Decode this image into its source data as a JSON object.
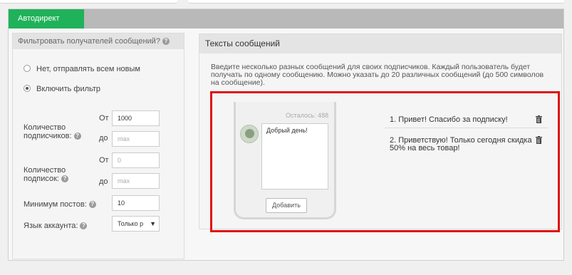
{
  "tab": {
    "label": "Автодирект"
  },
  "filter": {
    "title": "Фильтровать получателей сообщений?",
    "radio_all": "Нет, отправлять всем новым",
    "radio_filter": "Включить фильтр",
    "subscribers_label": "Количество подписчиков:",
    "subscriptions_label": "Количество подписок:",
    "from": "От",
    "to": "до",
    "subscribers_from": "1000",
    "max_placeholder": "max",
    "subscriptions_from_placeholder": "0",
    "min_posts_label": "Минимум постов:",
    "min_posts": "10",
    "lang_label": "Язык аккаунта:",
    "lang_value": "Только р"
  },
  "messages": {
    "title": "Тексты сообщений",
    "description": "Введите несколько разных сообщений для своих подписчиков. Каждый пользователь будет получать по одному сообщению. Можно указать до 20 различных сообщений (до 500 символов на сообщение).",
    "remaining": "Осталось: 488",
    "textarea_value": "Добрый день!",
    "add_button": "Добавить",
    "items": [
      "1.  Привет! Спасибо за подписку!",
      "2.  Приветствую! Только сегодня скидка 50% на весь товар!"
    ]
  },
  "colors": {
    "accent": "#1fb25a",
    "highlight": "#e01010"
  }
}
